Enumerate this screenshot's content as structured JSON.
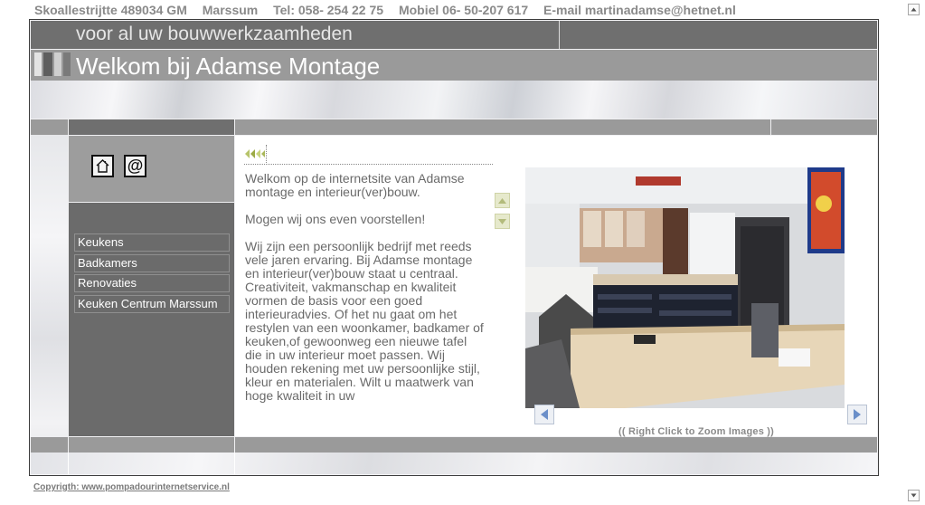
{
  "topbar": {
    "address": "Skoallestrijtte 489034 GM",
    "city": "Marssum",
    "tel": "Tel: 058- 254 22 75",
    "mobile": "Mobiel 06- 50-207 617",
    "email": "E-mail martinadamse@hetnet.nl"
  },
  "header": {
    "tagline": "voor al uw bouwwerkzaamheden",
    "welcome": "Welkom bij Adamse Montage"
  },
  "quicklinks": {
    "home_icon": "home-icon",
    "at_icon": "at-icon",
    "at_glyph": "@"
  },
  "nav": {
    "items": [
      {
        "label": "Keukens"
      },
      {
        "label": "Badkamers"
      },
      {
        "label": "Renovaties"
      },
      {
        "label": "Keuken Centrum Marssum"
      }
    ]
  },
  "content": {
    "paragraphs": [
      "Welkom op de internetsite van Adamse montage en interieur(ver)bouw.",
      "Mogen wij ons even voorstellen!",
      "Wij zijn een persoonlijk bedrijf met reeds vele jaren ervaring. Bij Adamse montage en interieur(ver)bouw staat u centraal. Creativiteit, vakmanschap en kwaliteit vormen de basis voor een goed interieuradvies. Of het nu gaat om het restylen van een woonkamer, badkamer of keuken,of gewoonweg een nieuwe tafel die in uw interieur moet passen. Wij houden rekening met uw persoonlijke stijl, kleur en materialen. Wilt u maatwerk van hoge kwaliteit in uw"
    ],
    "scroll_up_icon": "scroll-up-arrow-icon",
    "scroll_down_icon": "scroll-down-arrow-icon"
  },
  "gallery": {
    "zoom_hint": "(( Right Click to Zoom Images ))",
    "prev_icon": "arrow-left-icon",
    "next_icon": "arrow-right-icon"
  },
  "footer": {
    "copyright": "Copyrigth: www.pompadourinternetservice.nl"
  },
  "colors": {
    "dark_gray": "#6f6f6f",
    "mid_gray": "#9a9a9a",
    "text_gray": "#6a6a6a",
    "scroll_button_bg": "#e6e9cc",
    "gallery_arrow_blue": "#6b8fc9"
  }
}
